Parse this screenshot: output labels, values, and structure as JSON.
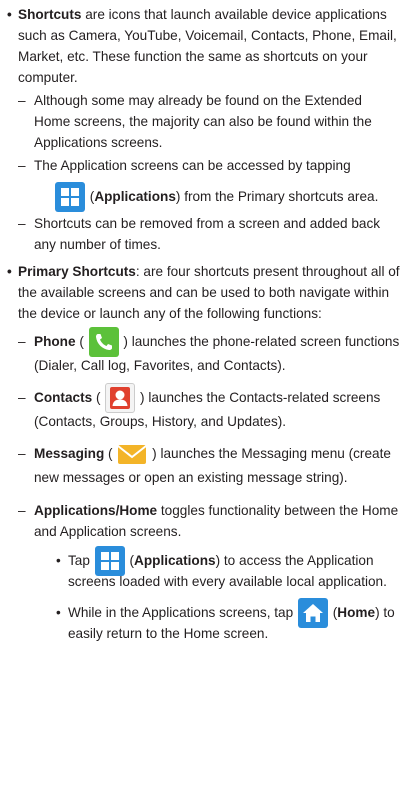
{
  "shortcuts": {
    "bullet": "•",
    "term": "Shortcuts",
    "text": " are icons that launch available device applications such as Camera, YouTube, Voicemail, Contacts, Phone, Email, Market, etc. These function the same as shortcuts on your computer.",
    "subs": [
      "Although some may already be found on the Extended Home screens, the majority can also be found within the Applications screens.",
      "The Application screens can be accessed by tapping"
    ],
    "apps_label": "Applications",
    "apps_suffix": " from the Primary shortcuts area.",
    "removed": "Shortcuts can be removed from a screen and added back any number of times."
  },
  "primary": {
    "bullet": "•",
    "term": "Primary Shortcuts",
    "text": ": are four shortcuts present throughout all of the available screens and can be used to both navigate within the device or launch any of the following functions:",
    "phone": {
      "term": "Phone",
      "text": " launches the phone-related screen functions (Dialer, Call log, Favorites, and Contacts)."
    },
    "contacts": {
      "term": "Contacts",
      "text": " launches the Contacts-related screens (Contacts, Groups, History, and Updates)."
    },
    "messaging": {
      "term": "Messaging",
      "text": " launches the Messaging menu (create new messages or open an existing message string)."
    },
    "apphome": {
      "term": "Applications/Home",
      "text": " toggles functionality between the Home and Application screens.",
      "tap_prefix": "Tap",
      "tap_label": "Applications",
      "tap_suffix": " to access the Application screens loaded with every available local application.",
      "home_prefix": "While in the Applications screens, tap",
      "home_label": "Home",
      "home_suffix": " to easily return to the Home screen."
    }
  },
  "glyphs": {
    "dash": "–",
    "dot": "•",
    "open": "(",
    "close": ")"
  },
  "icons": {
    "applications": "applications-grid-icon",
    "phone": "phone-handset-icon",
    "contacts": "contacts-person-icon",
    "messaging": "envelope-icon",
    "home": "home-icon"
  },
  "colors": {
    "text": "#231f20",
    "apps_blue": "#2a8ddb",
    "phone_green": "#5cc13a",
    "contacts_red": "#e0412f",
    "envelope_yellow": "#f3b428"
  }
}
